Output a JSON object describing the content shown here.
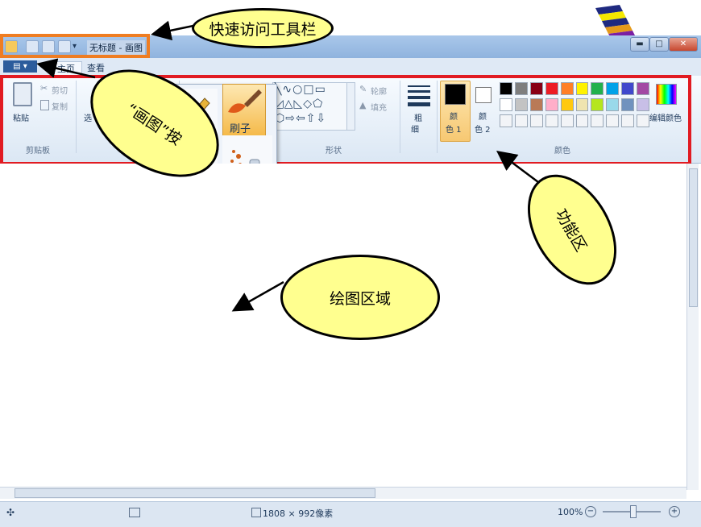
{
  "window": {
    "title": "无标题 - 画图",
    "controls": {
      "minimize": "▬",
      "maximize": "□",
      "close": "✕"
    }
  },
  "ribbon_tabs": {
    "paint_button": "▤ ▾",
    "home": "主页",
    "view": "查看"
  },
  "clipboard": {
    "paste": "粘贴",
    "cut": "剪切",
    "copy": "复制",
    "group": "剪贴板"
  },
  "image_group": {
    "select": "选"
  },
  "tools_popup": {
    "brush_label": "刷子"
  },
  "shapes": {
    "outline": "轮廓",
    "fill": "填充",
    "group": "形状"
  },
  "size": {
    "label_top": "粗",
    "label_bottom": "细"
  },
  "colors": {
    "color1_top": "颜",
    "color1_bottom": "色 1",
    "color2_top": "颜",
    "color2_bottom": "色 2",
    "edit": "编辑颜色",
    "group": "颜色",
    "palette_row1": [
      "#000000",
      "#7f7f7f",
      "#880015",
      "#ed1c24",
      "#ff7f27",
      "#fff200",
      "#22b14c",
      "#00a2e8",
      "#3f48cc",
      "#a349a4"
    ],
    "palette_row2": [
      "#ffffff",
      "#c3c3c3",
      "#b97a57",
      "#ffaec9",
      "#ffc90e",
      "#efe4b0",
      "#b5e61d",
      "#99d9ea",
      "#7092be",
      "#c8bfe7"
    ]
  },
  "status": {
    "dimensions": "1808 × 992像素",
    "zoom": "100%"
  },
  "callouts": {
    "quick_access": "快速访问工具栏",
    "paint_button": "“画图”按",
    "function_area": "功能区",
    "drawing_area": "绘图区域"
  }
}
